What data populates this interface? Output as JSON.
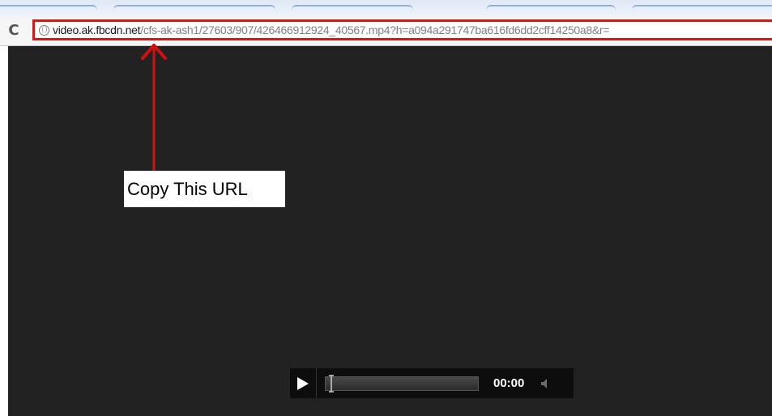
{
  "browser": {
    "reload_glyph": "C",
    "address": {
      "host": "video.ak.fbcdn.net",
      "path": "/cfs-ak-ash1/27603/907/426466912924_40567.mp4?h=a094a291747ba616fd6dd2cff14250a8&r="
    },
    "icons": {
      "reload": "reload-icon",
      "site_info": "globe-icon"
    },
    "highlight_color": "#cc1b1b"
  },
  "annotation": {
    "callout_text": "Copy This URL",
    "arrow_color": "#d01010"
  },
  "video": {
    "background_color": "#222222",
    "controls": {
      "time": "00:00",
      "progress": 0,
      "icons": {
        "play": "play-icon",
        "volume": "volume-icon"
      }
    }
  }
}
